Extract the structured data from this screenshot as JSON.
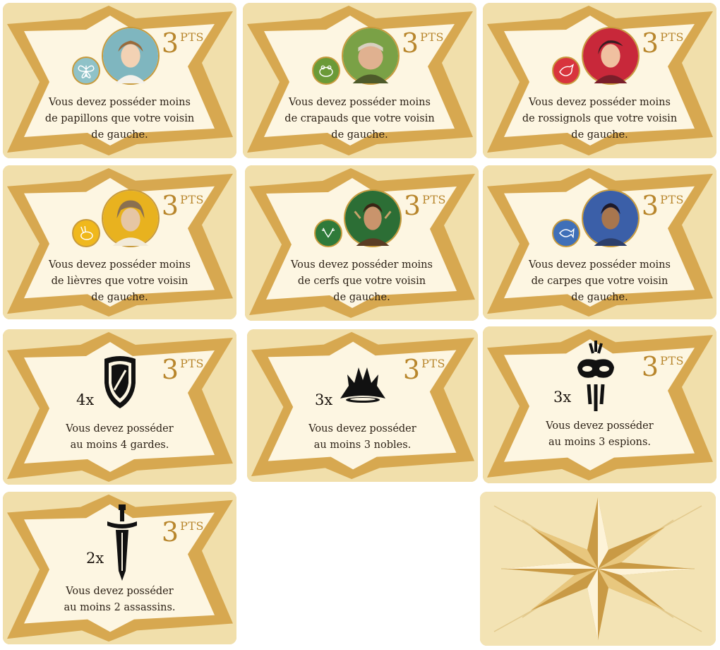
{
  "cards": [
    {
      "points": "3",
      "points_label": "PTS",
      "lines": [
        "Vous devez posséder moins",
        "de papillons que votre voisin",
        "de gauche."
      ],
      "badge_icon": "butterfly-icon",
      "badge_color": "#8fc2c8",
      "portrait_bg": "#7fb6bf"
    },
    {
      "points": "3",
      "points_label": "PTS",
      "lines": [
        "Vous devez posséder moins",
        "de crapauds que votre voisin",
        "de gauche."
      ],
      "badge_icon": "toad-icon",
      "badge_color": "#6b9a37",
      "portrait_bg": "#7aa146"
    },
    {
      "points": "3",
      "points_label": "PTS",
      "lines": [
        "Vous devez posséder moins",
        "de rossignols que votre voisin",
        "de gauche."
      ],
      "badge_icon": "nightingale-icon",
      "badge_color": "#d8343d",
      "portrait_bg": "#c8283a"
    },
    {
      "points": "3",
      "points_label": "PTS",
      "lines": [
        "Vous devez posséder moins",
        "de lièvres que votre voisin",
        "de gauche."
      ],
      "badge_icon": "hare-icon",
      "badge_color": "#f0b81c",
      "portrait_bg": "#e8b21f"
    },
    {
      "points": "3",
      "points_label": "PTS",
      "lines": [
        "Vous devez posséder moins",
        "de cerfs que votre voisin",
        "de gauche."
      ],
      "badge_icon": "stag-icon",
      "badge_color": "#2f7a3a",
      "portrait_bg": "#2c6e35"
    },
    {
      "points": "3",
      "points_label": "PTS",
      "lines": [
        "Vous devez posséder moins",
        "de carpes que votre voisin",
        "de gauche."
      ],
      "badge_icon": "carp-icon",
      "badge_color": "#3f6fb8",
      "portrait_bg": "#3b5fa8"
    },
    {
      "points": "3",
      "points_label": "PTS",
      "count": "4x",
      "lines": [
        "Vous devez posséder",
        "au moins 4 gardes."
      ],
      "emblem": "shield-icon"
    },
    {
      "points": "3",
      "points_label": "PTS",
      "count": "3x",
      "lines": [
        "Vous devez posséder",
        "au moins 3 nobles."
      ],
      "emblem": "crown-icon"
    },
    {
      "points": "3",
      "points_label": "PTS",
      "count": "3x",
      "lines": [
        "Vous devez posséder",
        "au moins 3 espions."
      ],
      "emblem": "mask-icon"
    },
    {
      "points": "3",
      "points_label": "PTS",
      "count": "2x",
      "lines": [
        "Vous devez posséder",
        "au moins 2 assassins."
      ],
      "emblem": "dagger-icon"
    }
  ],
  "card_back": {
    "emblem": "compass-star-icon"
  },
  "colors": {
    "card_bg": "#f1dfab",
    "star_band": "#d2a24e",
    "star_fill": "#fdf7e4",
    "gold_text": "#b8862c"
  }
}
